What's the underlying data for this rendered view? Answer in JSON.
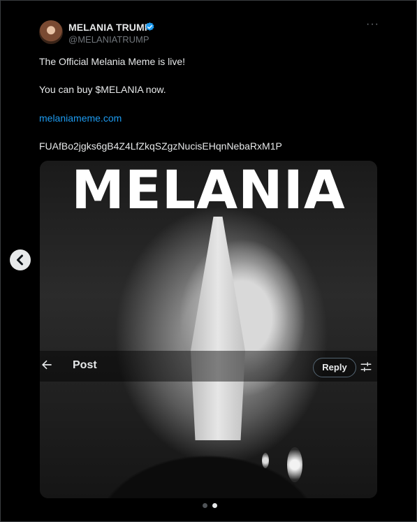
{
  "tweet": {
    "author_name": "MELANIA TRUMP",
    "author_handle": "@MELANIATRUMP",
    "more_icon": "more-horizontal-icon",
    "verified_icon": "verified-badge-icon",
    "lines": [
      "The Official Melania Meme is live!",
      "You can buy $MELANIA now.",
      "melaniameme.com",
      "FUAfBo2jgks6gB4Z4LfZkqSZgzNucisEHqnNebaRxM1P"
    ]
  },
  "media": {
    "overlay_title": "MELANIA",
    "post_bar": {
      "back_icon": "back-arrow-icon",
      "label": "Post",
      "reply_label": "Reply",
      "tune_icon": "tune-icon"
    }
  },
  "carousel": {
    "prev_icon": "chevron-left-icon",
    "dots": 2,
    "active_index": 1
  },
  "colors": {
    "background": "#000000",
    "text": "#e7e9ea",
    "muted": "#71767b",
    "link": "#1d9bf0",
    "verified": "#1d9bf0"
  }
}
